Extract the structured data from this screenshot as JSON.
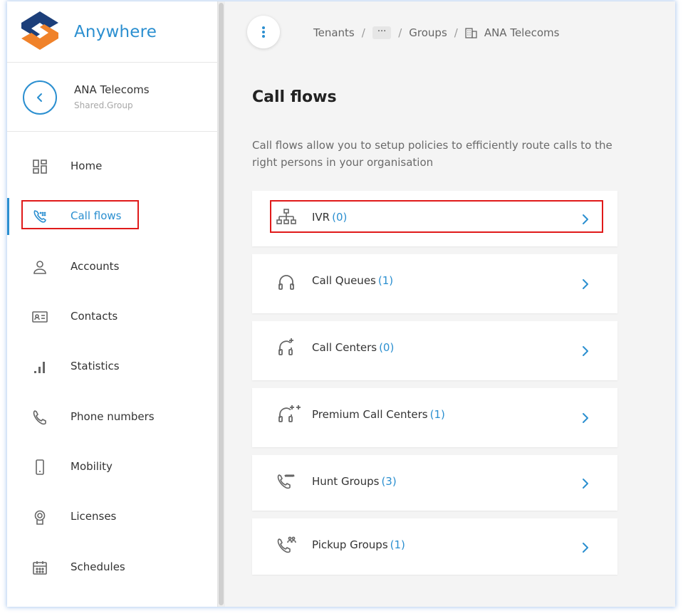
{
  "app": {
    "name": "Anywhere"
  },
  "tenant": {
    "name": "ANA Telecoms",
    "type": "Shared.Group"
  },
  "sidebar": {
    "items": [
      {
        "label": "Home",
        "icon": "dashboard-grid-icon"
      },
      {
        "label": "Call flows",
        "icon": "call-flows-icon",
        "active": true
      },
      {
        "label": "Accounts",
        "icon": "person-icon"
      },
      {
        "label": "Contacts",
        "icon": "contact-card-icon"
      },
      {
        "label": "Statistics",
        "icon": "bar-chart-icon"
      },
      {
        "label": "Phone numbers",
        "icon": "phone-icon"
      },
      {
        "label": "Mobility",
        "icon": "mobile-phone-icon"
      },
      {
        "label": "Licenses",
        "icon": "license-badge-icon"
      },
      {
        "label": "Schedules",
        "icon": "calendar-icon"
      }
    ]
  },
  "breadcrumb": {
    "items": [
      "Tenants",
      "···",
      "Groups",
      "ANA Telecoms"
    ],
    "separator": "/"
  },
  "main": {
    "title": "Call flows",
    "description": "Call flows allow you to setup policies to efficiently route calls to the right persons in your organisation",
    "cards": [
      {
        "label": "IVR",
        "count": "(0)",
        "icon": "ivr-hierarchy-icon"
      },
      {
        "label": "Call Queues",
        "count": "(1)",
        "icon": "headset-icon"
      },
      {
        "label": "Call Centers",
        "count": "(0)",
        "icon": "headset-plus-icon"
      },
      {
        "label": "Premium Call Centers",
        "count": "(1)",
        "icon": "headset-plus-plus-icon"
      },
      {
        "label": "Hunt Groups",
        "count": "(3)",
        "icon": "hunt-group-phone-icon"
      },
      {
        "label": "Pickup Groups",
        "count": "(1)",
        "icon": "pickup-group-phone-icon"
      }
    ]
  },
  "colors": {
    "accent": "#2b8fd0",
    "logo_orange": "#f0822a",
    "logo_navy": "#1c3f7a",
    "highlight": "#e01a1a",
    "icon_gray": "#666666"
  }
}
